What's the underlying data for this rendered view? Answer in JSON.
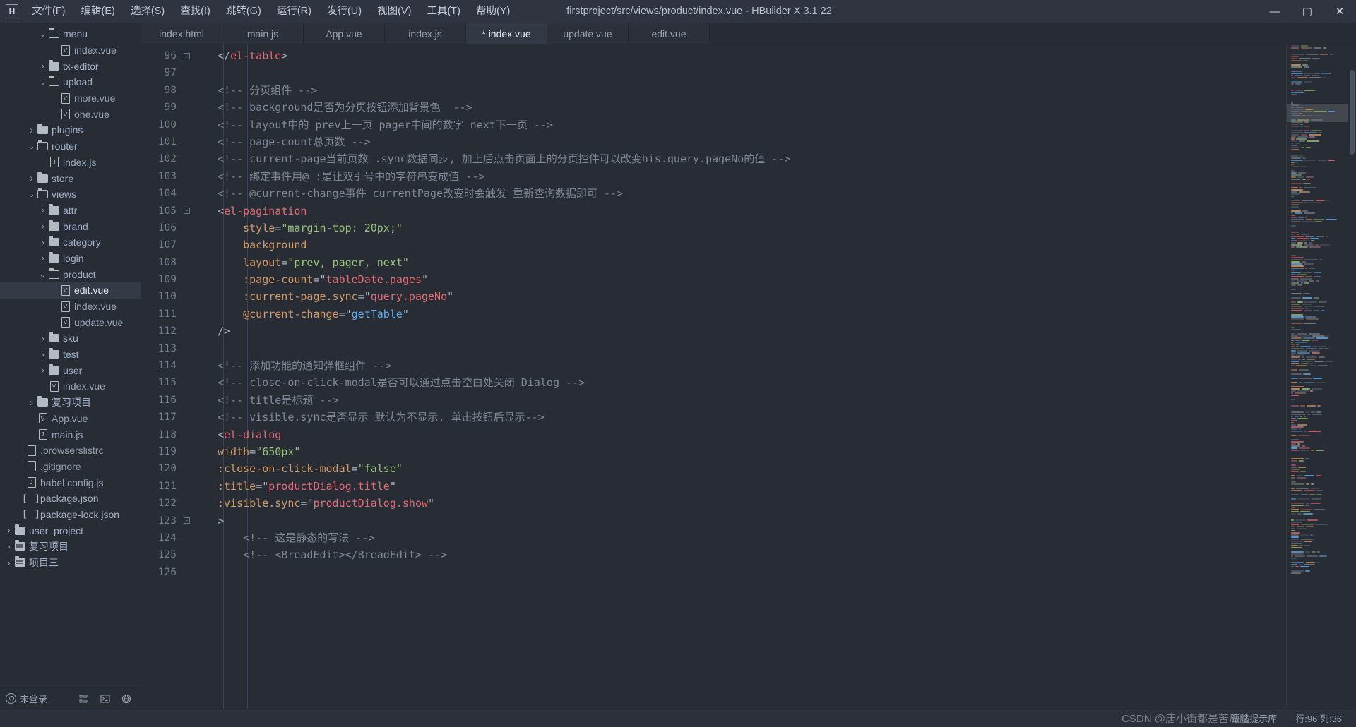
{
  "window": {
    "title": "firstproject/src/views/product/index.vue - HBuilder X 3.1.22",
    "logo": "H",
    "minimize": "—",
    "maximize": "▢",
    "close": "✕"
  },
  "menu": [
    {
      "label": "文件(F)",
      "name": "menu-file"
    },
    {
      "label": "编辑(E)",
      "name": "menu-edit"
    },
    {
      "label": "选择(S)",
      "name": "menu-select"
    },
    {
      "label": "查找(I)",
      "name": "menu-find"
    },
    {
      "label": "跳转(G)",
      "name": "menu-goto"
    },
    {
      "label": "运行(R)",
      "name": "menu-run"
    },
    {
      "label": "发行(U)",
      "name": "menu-publish"
    },
    {
      "label": "视图(V)",
      "name": "menu-view"
    },
    {
      "label": "工具(T)",
      "name": "menu-tools"
    },
    {
      "label": "帮助(Y)",
      "name": "menu-help"
    }
  ],
  "sidebar": {
    "tree": [
      {
        "label": "menu",
        "indent": 3,
        "arrow": "down",
        "icon": "folder-open",
        "type": "folder"
      },
      {
        "label": "index.vue",
        "indent": 4,
        "arrow": "none",
        "icon": "vue-file",
        "type": "vue"
      },
      {
        "label": "tx-editor",
        "indent": 3,
        "arrow": "right",
        "icon": "folder",
        "type": "folder"
      },
      {
        "label": "upload",
        "indent": 3,
        "arrow": "down",
        "icon": "folder-open",
        "type": "folder"
      },
      {
        "label": "more.vue",
        "indent": 4,
        "arrow": "none",
        "icon": "vue-file",
        "type": "vue"
      },
      {
        "label": "one.vue",
        "indent": 4,
        "arrow": "none",
        "icon": "vue-file",
        "type": "vue"
      },
      {
        "label": "plugins",
        "indent": 2,
        "arrow": "right",
        "icon": "folder",
        "type": "folder"
      },
      {
        "label": "router",
        "indent": 2,
        "arrow": "down",
        "icon": "folder-open",
        "type": "folder"
      },
      {
        "label": "index.js",
        "indent": 3,
        "arrow": "none",
        "icon": "js-file",
        "type": "js"
      },
      {
        "label": "store",
        "indent": 2,
        "arrow": "right",
        "icon": "folder",
        "type": "folder"
      },
      {
        "label": "views",
        "indent": 2,
        "arrow": "down",
        "icon": "folder-open",
        "type": "folder"
      },
      {
        "label": "attr",
        "indent": 3,
        "arrow": "right",
        "icon": "folder",
        "type": "folder"
      },
      {
        "label": "brand",
        "indent": 3,
        "arrow": "right",
        "icon": "folder",
        "type": "folder"
      },
      {
        "label": "category",
        "indent": 3,
        "arrow": "right",
        "icon": "folder",
        "type": "folder"
      },
      {
        "label": "login",
        "indent": 3,
        "arrow": "right",
        "icon": "folder",
        "type": "folder"
      },
      {
        "label": "product",
        "indent": 3,
        "arrow": "down",
        "icon": "folder-open",
        "type": "folder"
      },
      {
        "label": "edit.vue",
        "indent": 4,
        "arrow": "none",
        "icon": "vue-file",
        "type": "vue",
        "selected": true
      },
      {
        "label": "index.vue",
        "indent": 4,
        "arrow": "none",
        "icon": "vue-file",
        "type": "vue"
      },
      {
        "label": "update.vue",
        "indent": 4,
        "arrow": "none",
        "icon": "vue-file",
        "type": "vue"
      },
      {
        "label": "sku",
        "indent": 3,
        "arrow": "right",
        "icon": "folder",
        "type": "folder"
      },
      {
        "label": "test",
        "indent": 3,
        "arrow": "right",
        "icon": "folder",
        "type": "folder"
      },
      {
        "label": "user",
        "indent": 3,
        "arrow": "right",
        "icon": "folder",
        "type": "folder"
      },
      {
        "label": "index.vue",
        "indent": 3,
        "arrow": "none",
        "icon": "vue-file",
        "type": "vue"
      },
      {
        "label": "复习项目",
        "indent": 2,
        "arrow": "right",
        "icon": "folder",
        "type": "folder"
      },
      {
        "label": "App.vue",
        "indent": 2,
        "arrow": "none",
        "icon": "vue-file",
        "type": "vue"
      },
      {
        "label": "main.js",
        "indent": 2,
        "arrow": "none",
        "icon": "js-file",
        "type": "js"
      },
      {
        "label": ".browserslistrc",
        "indent": 1,
        "arrow": "none",
        "icon": "plain-file",
        "type": "plain"
      },
      {
        "label": ".gitignore",
        "indent": 1,
        "arrow": "none",
        "icon": "plain-file",
        "type": "plain"
      },
      {
        "label": "babel.config.js",
        "indent": 1,
        "arrow": "none",
        "icon": "js-file",
        "type": "js"
      },
      {
        "label": "package.json",
        "indent": 1,
        "arrow": "none",
        "icon": "json-file",
        "type": "json"
      },
      {
        "label": "package-lock.json",
        "indent": 1,
        "arrow": "none",
        "icon": "json-file",
        "type": "json"
      },
      {
        "label": "user_project",
        "indent": 0,
        "arrow": "right",
        "icon": "project",
        "type": "folder"
      },
      {
        "label": "复习项目",
        "indent": 0,
        "arrow": "right",
        "icon": "project",
        "type": "folder"
      },
      {
        "label": "项目三",
        "indent": 0,
        "arrow": "right",
        "icon": "project",
        "type": "folder"
      }
    ],
    "bottom": {
      "user_status": "未登录",
      "icons": [
        "list-icon",
        "terminal-icon",
        "globe-icon"
      ]
    }
  },
  "tabs": [
    {
      "label": "index.html",
      "active": false,
      "name": "tab-index-html"
    },
    {
      "label": "main.js",
      "active": false,
      "name": "tab-main-js"
    },
    {
      "label": "App.vue",
      "active": false,
      "name": "tab-app-vue"
    },
    {
      "label": "index.js",
      "active": false,
      "name": "tab-index-js"
    },
    {
      "label": "* index.vue",
      "active": true,
      "name": "tab-index-vue"
    },
    {
      "label": "update.vue",
      "active": false,
      "name": "tab-update-vue"
    },
    {
      "label": "edit.vue",
      "active": false,
      "name": "tab-edit-vue"
    }
  ],
  "editor": {
    "first_line": 96,
    "lines": [
      {
        "n": 96,
        "fold": true,
        "tokens": [
          [
            "br",
            "</"
          ],
          [
            "tg",
            "el-table"
          ],
          [
            "br",
            ">"
          ]
        ]
      },
      {
        "n": 97,
        "tokens": []
      },
      {
        "n": 98,
        "tokens": [
          [
            "cm",
            "<!-- 分页组件 -->"
          ]
        ]
      },
      {
        "n": 99,
        "tokens": [
          [
            "cm",
            "<!-- background是否为分页按钮添加背景色  -->"
          ]
        ]
      },
      {
        "n": 100,
        "tokens": [
          [
            "cm",
            "<!-- layout中的 prev上一页 pager中间的数字 next下一页 -->"
          ]
        ]
      },
      {
        "n": 101,
        "tokens": [
          [
            "cm",
            "<!-- page-count总页数 -->"
          ]
        ]
      },
      {
        "n": 102,
        "tokens": [
          [
            "cm",
            "<!-- current-page当前页数 .sync数据同步, 加上后点击页面上的分页控件可以改变his.query.pageNo的值 -->"
          ]
        ]
      },
      {
        "n": 103,
        "tokens": [
          [
            "cm",
            "<!-- 绑定事件用@ :是让双引号中的字符串变成值 -->"
          ]
        ]
      },
      {
        "n": 104,
        "tokens": [
          [
            "cm",
            "<!-- @current-change事件 currentPage改变时会触发 重新查询数据即可 -->"
          ]
        ]
      },
      {
        "n": 105,
        "fold": true,
        "tokens": [
          [
            "br",
            "<"
          ],
          [
            "tg",
            "el-pagination"
          ]
        ]
      },
      {
        "n": 106,
        "tokens": [
          [
            "pad",
            "    "
          ],
          [
            "at",
            "style"
          ],
          [
            "br",
            "="
          ],
          [
            "st",
            "\"margin-top: 20px;\""
          ]
        ]
      },
      {
        "n": 107,
        "tokens": [
          [
            "pad",
            "    "
          ],
          [
            "at",
            "background"
          ]
        ]
      },
      {
        "n": 108,
        "tokens": [
          [
            "pad",
            "    "
          ],
          [
            "at",
            "layout"
          ],
          [
            "br",
            "="
          ],
          [
            "st",
            "\"prev, pager, next\""
          ]
        ]
      },
      {
        "n": 109,
        "tokens": [
          [
            "pad",
            "    "
          ],
          [
            "at",
            ":page-count"
          ],
          [
            "br",
            "="
          ],
          [
            "br",
            "\""
          ],
          [
            "vr",
            "tableDate.pages"
          ],
          [
            "br",
            "\""
          ]
        ]
      },
      {
        "n": 110,
        "tokens": [
          [
            "pad",
            "    "
          ],
          [
            "at",
            ":current-page.sync"
          ],
          [
            "br",
            "="
          ],
          [
            "br",
            "\""
          ],
          [
            "vr",
            "query.pageNo"
          ],
          [
            "br",
            "\""
          ]
        ]
      },
      {
        "n": 111,
        "tokens": [
          [
            "pad",
            "    "
          ],
          [
            "at",
            "@current-change"
          ],
          [
            "br",
            "="
          ],
          [
            "br",
            "\""
          ],
          [
            "fn",
            "getTable"
          ],
          [
            "br",
            "\""
          ]
        ]
      },
      {
        "n": 112,
        "tokens": [
          [
            "br",
            "/>"
          ]
        ]
      },
      {
        "n": 113,
        "tokens": []
      },
      {
        "n": 114,
        "tokens": [
          [
            "cm",
            "<!-- 添加功能的通知弹框组件 -->"
          ]
        ]
      },
      {
        "n": 115,
        "tokens": [
          [
            "cm",
            "<!-- close-on-click-modal是否可以通过点击空白处关闭 Dialog -->"
          ]
        ]
      },
      {
        "n": 116,
        "tokens": [
          [
            "cm",
            "<!-- title是标题 -->"
          ]
        ]
      },
      {
        "n": 117,
        "tokens": [
          [
            "cm",
            "<!-- visible.sync是否显示 默认为不显示, 单击按钮后显示-->"
          ]
        ]
      },
      {
        "n": 118,
        "tokens": [
          [
            "br",
            "<"
          ],
          [
            "tg",
            "el-dialog"
          ]
        ]
      },
      {
        "n": 119,
        "tokens": [
          [
            "at",
            "width"
          ],
          [
            "br",
            "="
          ],
          [
            "st",
            "\"650px\""
          ]
        ]
      },
      {
        "n": 120,
        "tokens": [
          [
            "at",
            ":close-on-click-modal"
          ],
          [
            "br",
            "="
          ],
          [
            "st",
            "\"false\""
          ]
        ]
      },
      {
        "n": 121,
        "tokens": [
          [
            "at",
            ":title"
          ],
          [
            "br",
            "="
          ],
          [
            "br",
            "\""
          ],
          [
            "vr",
            "productDialog.title"
          ],
          [
            "br",
            "\""
          ]
        ]
      },
      {
        "n": 122,
        "tokens": [
          [
            "at",
            ":visible.sync"
          ],
          [
            "br",
            "="
          ],
          [
            "br",
            "\""
          ],
          [
            "vr",
            "productDialog.show"
          ],
          [
            "br",
            "\""
          ]
        ]
      },
      {
        "n": 123,
        "fold": true,
        "tokens": [
          [
            "br",
            ">"
          ]
        ]
      },
      {
        "n": 124,
        "tokens": [
          [
            "pad",
            "    "
          ],
          [
            "cm",
            "<!-- 这是静态的写法 -->"
          ]
        ]
      },
      {
        "n": 125,
        "tokens": [
          [
            "pad",
            "    "
          ],
          [
            "cm",
            "<!-- <BreadEdit></BreadEdit> -->"
          ]
        ]
      },
      {
        "n": 126,
        "tokens": []
      }
    ],
    "colors": {
      "comment": "#7f8796",
      "tag": "#e06c75",
      "attribute": "#d19a66",
      "string": "#98c379",
      "variable": "#e06c75",
      "function": "#61afef",
      "punctuation": "#abb2bf",
      "background": "#282c34"
    }
  },
  "statusbar": {
    "syntax_hint": "语法提示库",
    "cursor": "行:96 列:36",
    "watermark": "CSDN @唐小街都是苦瓜脸"
  }
}
